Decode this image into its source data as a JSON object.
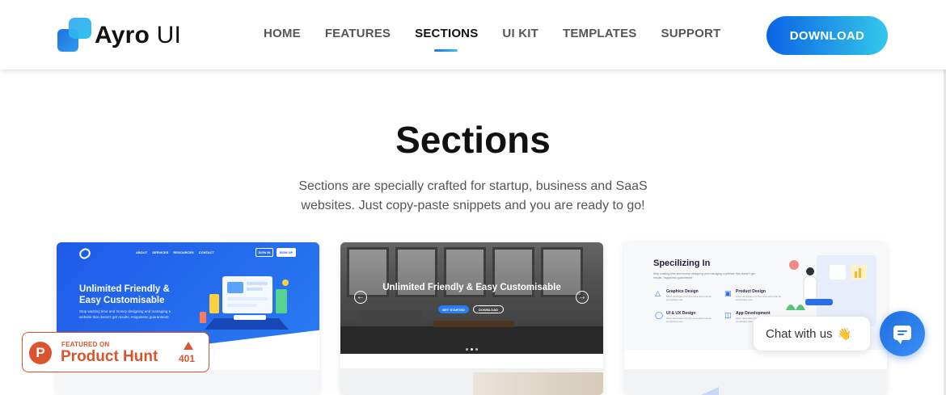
{
  "brand": {
    "name_bold": "Ayro",
    "name_light": "UI"
  },
  "nav": {
    "items": [
      {
        "label": "HOME",
        "active": false
      },
      {
        "label": "FEATURES",
        "active": false
      },
      {
        "label": "SECTIONS",
        "active": true
      },
      {
        "label": "UI KIT",
        "active": false
      },
      {
        "label": "TEMPLATES",
        "active": false
      },
      {
        "label": "SUPPORT",
        "active": false
      }
    ],
    "download_label": "DOWNLOAD"
  },
  "hero": {
    "title": "Sections",
    "subtitle": "Sections are specially crafted for startup, business and SaaS websites. Just copy-paste snippets and you are ready to go!"
  },
  "cards": [
    {
      "nav": [
        "ABOUT",
        "SERVICES",
        "RESOURCES",
        "CONTACT"
      ],
      "sign_in": "SIGN IN",
      "sign_up": "SIGN UP",
      "heading": "Unlimited Friendly & Easy Customisable",
      "text": "Stop wasting time and money designing and managing a website that doesn't get results. Happiness guaranteed!"
    },
    {
      "heading": "Unlimited Friendly & Easy Customisable",
      "btn_primary": "GET STARTED",
      "btn_secondary": "DOWNLOAD"
    },
    {
      "title": "Specilizing In",
      "desc": "Stop wasting time and money designing and managing a website that doesn't get results. Happiness guaranteed!",
      "items": [
        {
          "title": "Graphics Design",
          "desc": "Short description for the ones who look for something new."
        },
        {
          "title": "Product Design",
          "desc": "Short description for the ones who look for something new."
        },
        {
          "title": "UI & UX Design",
          "desc": "Short description for the ones who look for something new."
        },
        {
          "title": "App Development",
          "desc": "Short description for the ones who look for something new."
        }
      ]
    }
  ],
  "product_hunt": {
    "featured": "FEATURED ON",
    "name": "Product Hunt",
    "logo_letter": "P",
    "count": "401"
  },
  "chat": {
    "text": "Chat with us",
    "wave_icon": "👋"
  },
  "colors": {
    "accent": "#0b63e5",
    "accent_end": "#33c8ea",
    "product_hunt": "#da552f"
  }
}
